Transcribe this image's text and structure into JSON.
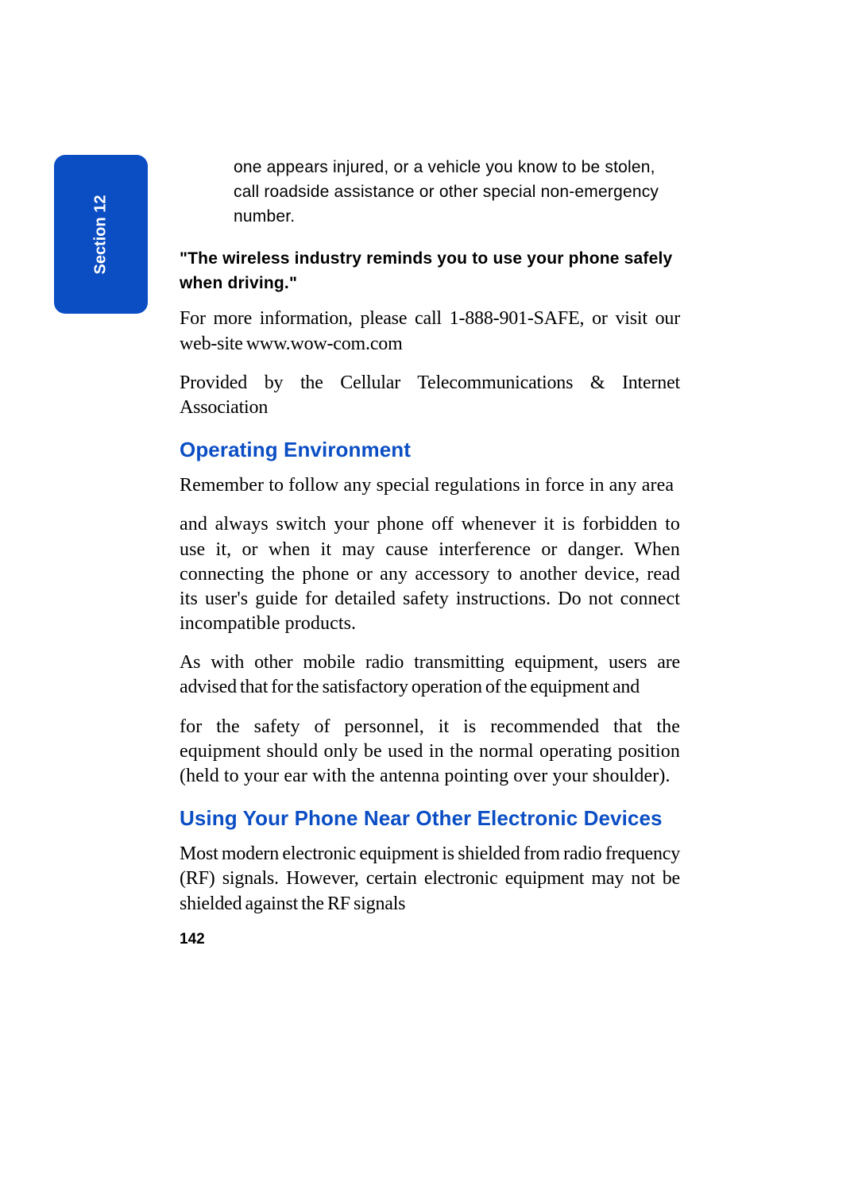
{
  "sideTab": {
    "label": "Section 12"
  },
  "content": {
    "continuedText": "one appears injured, or a vehicle you know to be stolen, call roadside assistance or other special non-emergency number.",
    "boldQuote": "\"The wireless industry reminds you to use your phone safely when driving.\"",
    "paragraph1": "For more information, please call 1-888-901-SAFE, or visit our web-site www.wow-com.com",
    "paragraph2": "Provided by the Cellular Telecommunications & Internet Association",
    "heading1": "Operating Environment",
    "paragraph3": "Remember to follow any special regulations in force in any area",
    "paragraph4": "and always switch your phone off whenever it is forbidden to use it, or when it may cause interference or danger. When connecting the phone or any accessory to another device, read its user's guide for detailed safety instructions. Do not connect incompatible products.",
    "paragraph5": "As with other mobile radio transmitting equipment, users are advised that for the satisfactory operation of the equipment and",
    "paragraph6": "for the safety of personnel, it is recommended that the equipment should only be used in the normal operating position (held to your ear with the antenna pointing over your shoulder).",
    "heading2": "Using Your Phone Near Other Electronic Devices",
    "paragraph7": "Most modern electronic equipment is shielded from radio frequency (RF) signals. However, certain electronic equipment may not be shielded against the RF signals",
    "pageNumber": "142"
  }
}
